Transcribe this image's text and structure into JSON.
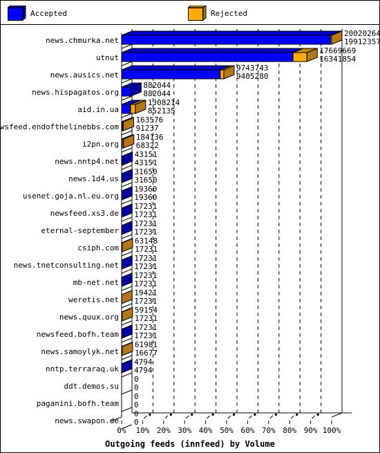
{
  "colors": {
    "accepted_front": "#0000ff",
    "accepted_top": "#0000c8",
    "accepted_side": "#0000a0",
    "rejected_front": "#ffaa00",
    "rejected_top": "#c88a00",
    "rejected_side": "#b07818",
    "outline": "#000000",
    "background": "#ffffff"
  },
  "legend": [
    {
      "name": "Accepted",
      "color_key": "accepted"
    },
    {
      "name": "Rejected",
      "color_key": "rejected"
    }
  ],
  "chart_data": {
    "type": "bar",
    "orientation": "horizontal",
    "stacked": true,
    "style": "3d",
    "title": "",
    "xlabel": "Outgoing feeds (innfeed) by Volume",
    "ylabel": "",
    "xlim": [
      0,
      100
    ],
    "x_unit": "%",
    "x_ticks": [
      "0%",
      "10%",
      "20%",
      "30%",
      "40%",
      "50%",
      "60%",
      "70%",
      "80%",
      "90%",
      "100%"
    ],
    "grid": "vertical dashed",
    "legend_position": "top",
    "categories": [
      "news.chmurka.net",
      "utnut",
      "news.ausics.net",
      "news.hispagatos.org",
      "aid.in.ua",
      "newsfeed.endofthelinebbs.com",
      "i2pn.org",
      "news.nntp4.net",
      "news.1d4.us",
      "usenet.goja.nl.eu.org",
      "newsfeed.xs3.de",
      "eternal-september",
      "csiph.com",
      "news.tnetconsulting.net",
      "mb-net.net",
      "weretis.net",
      "news.quux.org",
      "newsfeed.bofh.team",
      "news.samoylyk.net",
      "nntp.terraraq.uk",
      "ddt.demos.su",
      "paganini.bofh.team",
      "news.swapon.de"
    ],
    "totals": [
      20020264,
      17669669,
      9743743,
      882044,
      1308214,
      163576,
      184136,
      43151,
      31650,
      19360,
      17231,
      17231,
      63148,
      17231,
      17231,
      19421,
      59154,
      17231,
      61981,
      4794,
      0,
      0,
      0
    ],
    "series": [
      {
        "name": "Accepted",
        "values": [
          19912357,
          16341854,
          9405280,
          882044,
          852135,
          91237,
          68322,
          43151,
          31650,
          19360,
          17231,
          17231,
          17231,
          17231,
          17231,
          17231,
          17231,
          17231,
          16677,
          4794,
          0,
          0,
          0
        ]
      },
      {
        "name": "Rejected",
        "values": [
          107907,
          1327815,
          338463,
          0,
          456079,
          72339,
          115814,
          0,
          0,
          0,
          0,
          0,
          45917,
          0,
          0,
          2190,
          41923,
          0,
          45304,
          0,
          0,
          0,
          0
        ]
      }
    ],
    "scale_max": 20020264
  }
}
